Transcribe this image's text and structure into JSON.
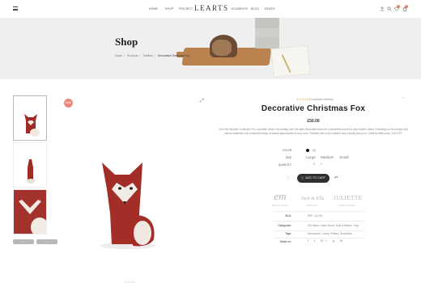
{
  "header": {
    "logo": "LEARTS",
    "nav": [
      "HOME",
      "SHOP",
      "PROJECT",
      "ELEMENTS",
      "BLOG",
      "PAGES"
    ],
    "wishlist_count": "0",
    "cart_count": "0"
  },
  "banner": {
    "title": "Shop",
    "breadcrumbs": [
      "Home",
      "Products",
      "Toddlers",
      "Decorative Christmas Fox"
    ]
  },
  "thumbnail_nav": {
    "prev": "‹",
    "next": "›"
  },
  "main_image": {
    "badge": "Sale"
  },
  "product": {
    "rating": 5,
    "stars": "★★★★★",
    "reviews": "(3 customer reviews)",
    "title": "Decorative Christmas Fox",
    "price": "£50.00",
    "description": "Over the Wooden Collection Pro, adorable dream fox looking over the sight chocolate would be a wonderful accent to any modern décor. Featuring a a fox design and natural materials, this ornament brings a relaxed appearance to any room. Finished with a red sweater and a small pom-pom. Great for little ones. 10% OFF.",
    "color_label": "COLOR",
    "colors": [
      "#1a1a1a",
      "#d9d9d9"
    ],
    "size_label": "SIZE",
    "sizes": [
      "Large",
      "Medium",
      "Small"
    ],
    "quantity_label": "QUANTITY",
    "quantity": "1",
    "qty_minus": "-",
    "qty_plus": "+",
    "add_to_cart": "ADD TO CART",
    "brands": [
      {
        "name": "em",
        "sub": "BOUTIQUE"
      },
      {
        "name": "Jack & Ella",
        "sub": "BRIDAL"
      },
      {
        "name": "JULIETTE",
        "sub": "CREATIONS"
      }
    ],
    "meta": [
      {
        "label": "SKU:",
        "value": "REF. LA-276"
      },
      {
        "label": "Categories:",
        "value": "Gift Ideas, Home Decor, Kids & Babies, Toys"
      },
      {
        "label": "Tags:",
        "value": "Handmade, Lovely, Pottery, Decoration"
      },
      {
        "label": "Share on:",
        "value": ""
      }
    ],
    "social": [
      "f",
      "t",
      "G+",
      "p",
      "✉"
    ]
  }
}
